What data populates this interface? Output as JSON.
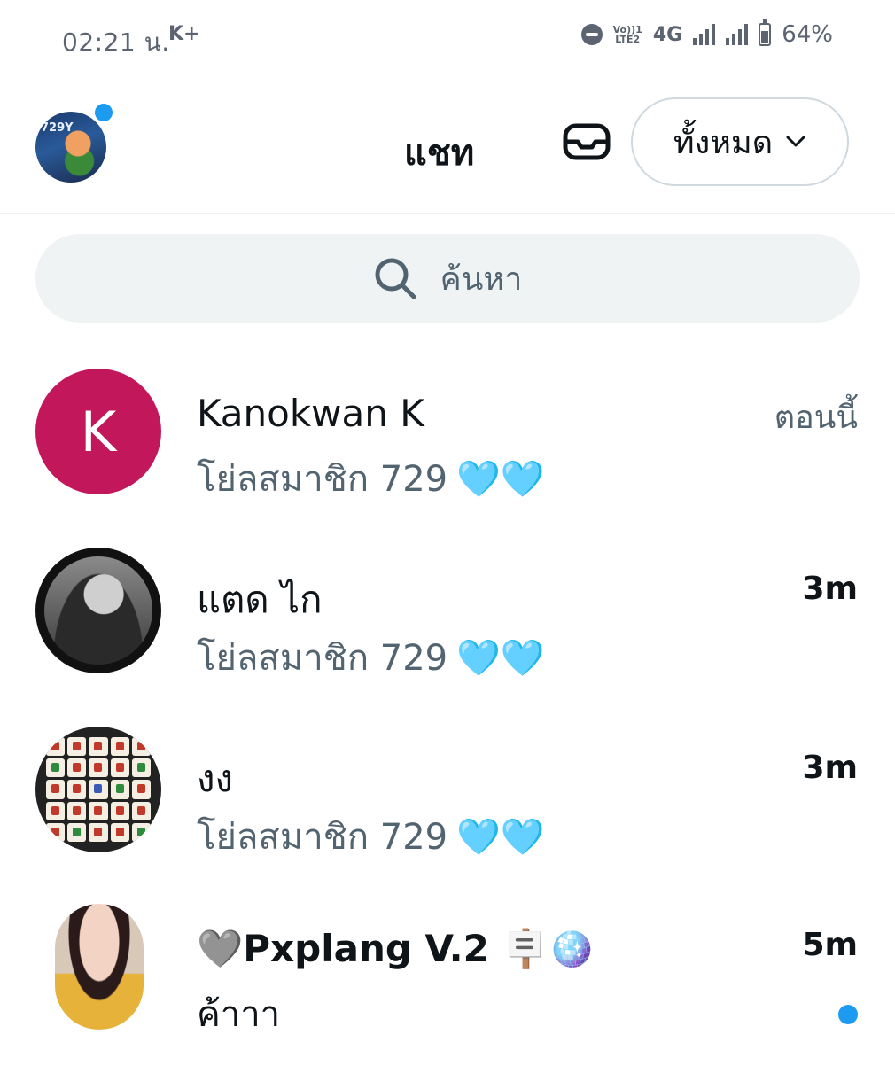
{
  "status_bar": {
    "time": "02:21 น.",
    "carrier_badge": "K+",
    "volte_top": "Vo))1",
    "volte_bottom": "LTE2",
    "network": "4G",
    "battery": "64%",
    "battery_level": 0.64
  },
  "header": {
    "title": "แชท",
    "filter_label": "ทั้งหมด",
    "avatar_text": "729Y"
  },
  "search": {
    "placeholder": "ค้นหา"
  },
  "conversations": [
    {
      "name": "Kanokwan K",
      "avatar_letter": "K",
      "preview": "โย่ลสมาชิก 729",
      "preview_emoji": "🩵🩵",
      "time": "ตอนนี้",
      "unread": false
    },
    {
      "name": "แตด ไก",
      "preview": "โย่ลสมาชิก 729",
      "preview_emoji": "🩵🩵",
      "time": "3m",
      "unread": false
    },
    {
      "name": "งง",
      "preview": "โย่ลสมาชิก 729",
      "preview_emoji": "🩵🩵",
      "time": "3m",
      "unread": false
    },
    {
      "name": "🩶Pxplang V.2 🪧🪩",
      "preview": "ค้าาา",
      "time": "5m",
      "unread": true
    }
  ],
  "colors": {
    "accent": "#1d9bf0",
    "avatar_k": "#c2185b",
    "secondary_text": "#536471",
    "heart": "#5bc8f0"
  }
}
